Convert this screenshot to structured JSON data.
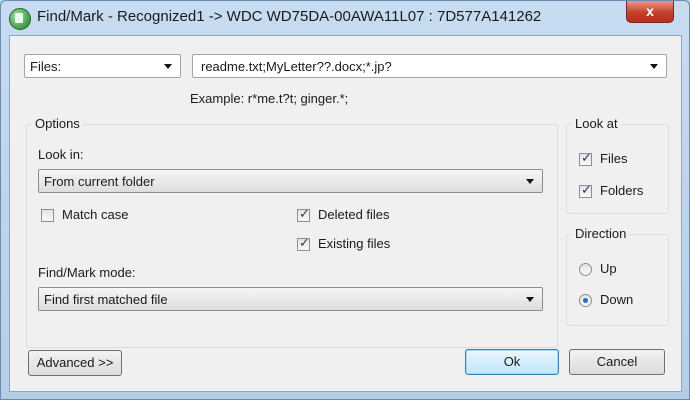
{
  "window": {
    "title": "Find/Mark - Recognized1 -> WDC WD75DA-00AWA11L07 : 7D577A141262",
    "close_glyph": "x"
  },
  "criteria": {
    "type_selected": "Files:",
    "pattern_value": "readme.txt;MyLetter??.docx;*.jp?",
    "example_text": "Example: r*me.t?t; ginger.*;"
  },
  "options": {
    "legend": "Options",
    "look_in_label": "Look in:",
    "look_in_value": "From current folder",
    "match_case_label": "Match case",
    "match_case_checked": false,
    "deleted_files_label": "Deleted files",
    "deleted_files_checked": true,
    "existing_files_label": "Existing files",
    "existing_files_checked": true,
    "mode_label": "Find/Mark mode:",
    "mode_value": "Find first matched file"
  },
  "look_at": {
    "legend": "Look at",
    "files_label": "Files",
    "files_checked": true,
    "folders_label": "Folders",
    "folders_checked": true
  },
  "direction": {
    "legend": "Direction",
    "up_label": "Up",
    "down_label": "Down",
    "selected": "Down"
  },
  "buttons": {
    "advanced": "Advanced >>",
    "ok": "Ok",
    "cancel": "Cancel"
  }
}
